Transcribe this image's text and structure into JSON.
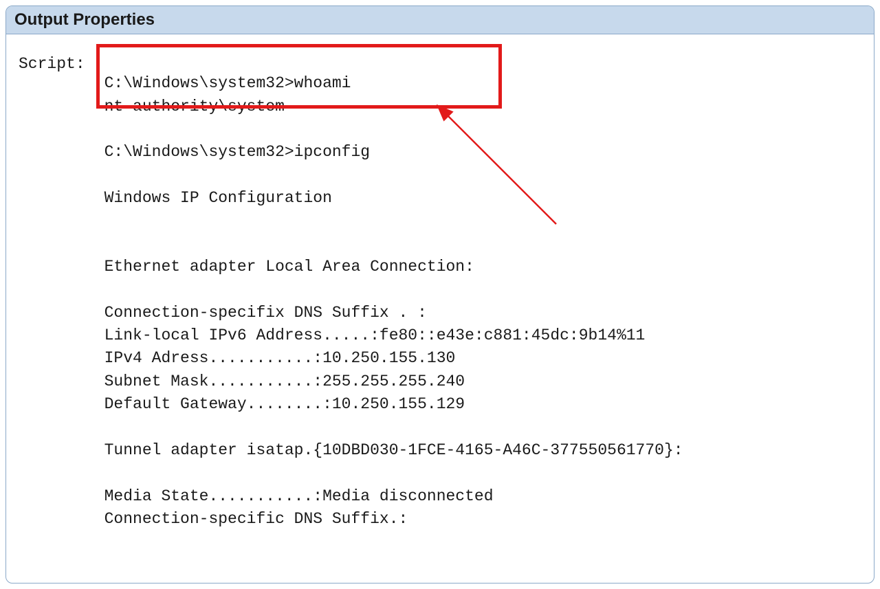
{
  "header": {
    "title": "Output Properties"
  },
  "field": {
    "label": "Script:"
  },
  "script": {
    "line_whoami_cmd": "C:\\Windows\\system32>whoami",
    "line_whoami_out": "nt authority\\system",
    "line_blank1": "",
    "line_ipconfig_cmd": "C:\\Windows\\system32>ipconfig",
    "line_blank2": "",
    "line_winip": "Windows IP Configuration",
    "line_blank3": "",
    "line_blank4": "",
    "line_eth": "Ethernet adapter Local Area Connection:",
    "line_blank5": "",
    "line_dns1": "Connection-specifix DNS Suffix . :",
    "line_ipv6": "Link-local IPv6 Address.....:fe80::e43e:c881:45dc:9b14%11",
    "line_ipv4": "IPv4 Adress...........:10.250.155.130",
    "line_subnet": "Subnet Mask...........:255.255.255.240",
    "line_gateway": "Default Gateway........:10.250.155.129",
    "line_blank6": "",
    "line_tunnel": "Tunnel adapter isatap.{10DBD030-1FCE-4165-A46C-377550561770}:",
    "line_blank7": "",
    "line_media": "Media State...........:Media disconnected",
    "line_dns2": "Connection-specific DNS Suffix.:"
  },
  "annotation": {
    "highlight_color": "#e21a1a",
    "arrow_color": "#e21a1a"
  }
}
